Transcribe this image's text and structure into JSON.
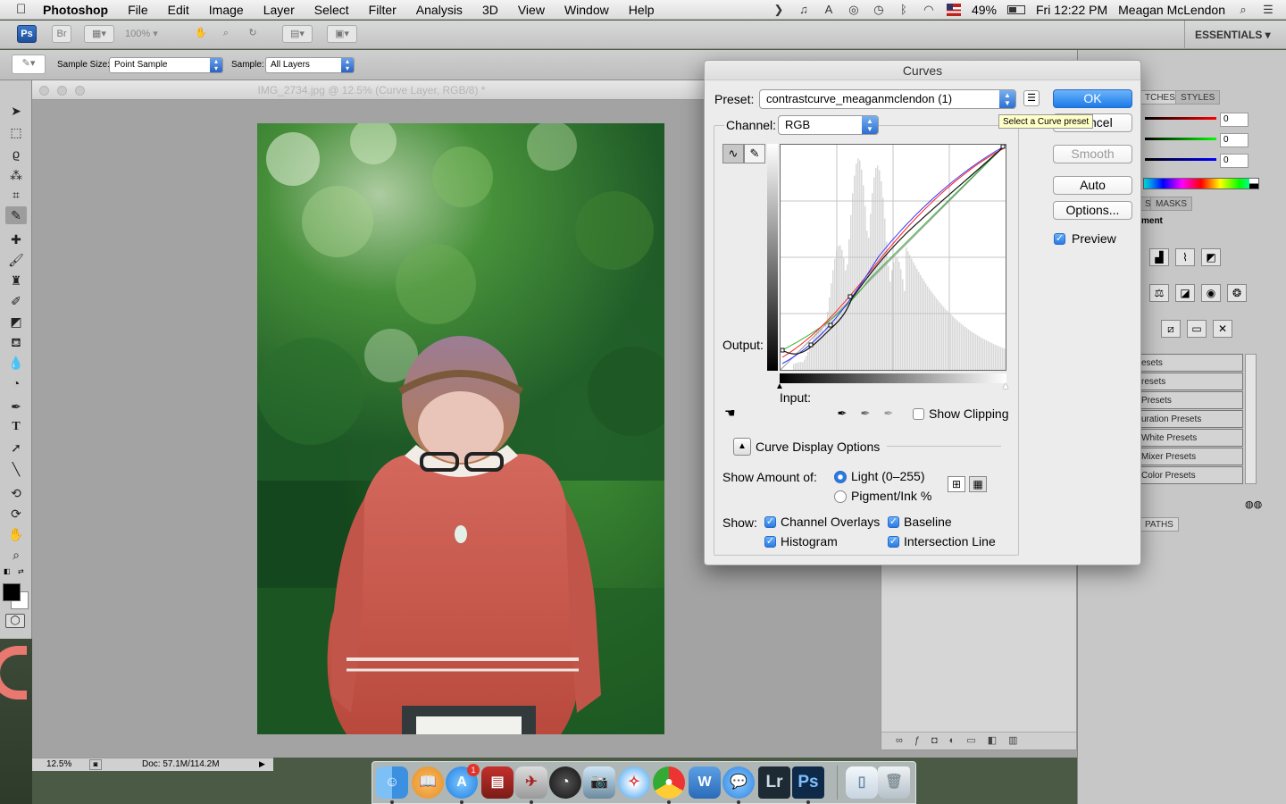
{
  "menubar": {
    "app_name": "Photoshop",
    "items": [
      "File",
      "Edit",
      "Image",
      "Layer",
      "Select",
      "Filter",
      "Analysis",
      "3D",
      "View",
      "Window",
      "Help"
    ],
    "battery": "49%",
    "clock": "Fri 12:22 PM",
    "user": "Meagan McLendon"
  },
  "appbar": {
    "ps_badge": "Ps",
    "br_badge": "Br",
    "zoom": "100%",
    "workspace": "ESSENTIALS ▾"
  },
  "options": {
    "sample_size_label": "Sample Size:",
    "sample_size_value": "Point Sample",
    "sample_label": "Sample:",
    "sample_value": "All Layers"
  },
  "document": {
    "title": "IMG_2734.jpg @ 12.5% (Curve Layer, RGB/8) *",
    "zoom": "12.5%",
    "doc_size": "Doc: 57.1M/114.2M"
  },
  "panels": {
    "tab_swatches": "TCHES",
    "tab_styles": "STYLES",
    "rgb_r": "0",
    "rgb_g": "0",
    "rgb_b": "0",
    "tab_adjust": "S",
    "tab_masks": "MASKS",
    "adjust_heading": "ment",
    "presets": [
      "esets",
      "resets",
      "Presets",
      "uration Presets",
      "White Presets",
      "Mixer Presets",
      "Color Presets"
    ],
    "tab_paths": "PATHS"
  },
  "curves": {
    "title": "Curves",
    "preset_label": "Preset:",
    "preset_value": "contrastcurve_meaganmclendon (1)",
    "tooltip": "Select a Curve preset",
    "channel_label": "Channel:",
    "channel_value": "RGB",
    "output_label": "Output:",
    "input_label": "Input:",
    "show_clipping": "Show Clipping",
    "display_options": "Curve Display Options",
    "show_amount_label": "Show Amount of:",
    "light_label": "Light  (0–255)",
    "pigment_label": "Pigment/Ink %",
    "show_label": "Show:",
    "channel_overlays": "Channel Overlays",
    "baseline": "Baseline",
    "histogram": "Histogram",
    "intersection_line": "Intersection Line",
    "ok": "OK",
    "cancel": "ncel",
    "smooth": "Smooth",
    "auto": "Auto",
    "options": "Options...",
    "preview": "Preview",
    "colors": {
      "curve_rgb": "#111111",
      "curve_red": "#ff2020",
      "curve_green": "#2db52d",
      "curve_blue": "#3030ff",
      "accent": "#2a7ae4"
    }
  },
  "dock": {
    "badge": "1",
    "lr": "Lr",
    "ps": "Ps"
  }
}
